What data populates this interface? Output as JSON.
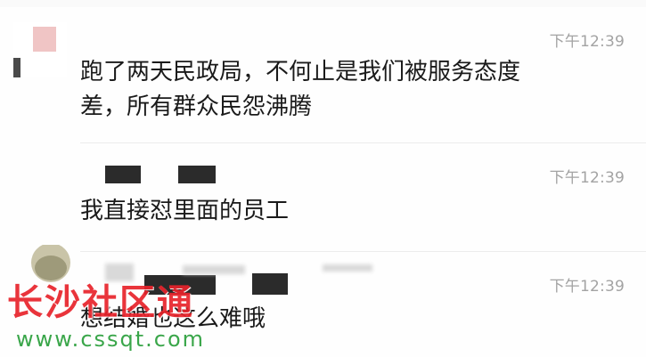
{
  "messages": [
    {
      "time": "下午12:39",
      "lines": [
        "跑了两天民政局，不何止是我们被服务态度",
        "差，所有群众民怨沸腾"
      ]
    },
    {
      "time": "下午12:39",
      "lines": [
        "我直接怼里面的员工"
      ]
    },
    {
      "time": "下午12:39",
      "lines": [
        "想结婚也这么难哦"
      ]
    }
  ],
  "watermark": {
    "title": "长沙社区通",
    "url": "www.cssqt.com"
  },
  "colors": {
    "timestamp": "#a3a3a3",
    "text": "#1a1a1a",
    "watermark_red": "#e8232b",
    "watermark_green": "#3aa64a"
  }
}
